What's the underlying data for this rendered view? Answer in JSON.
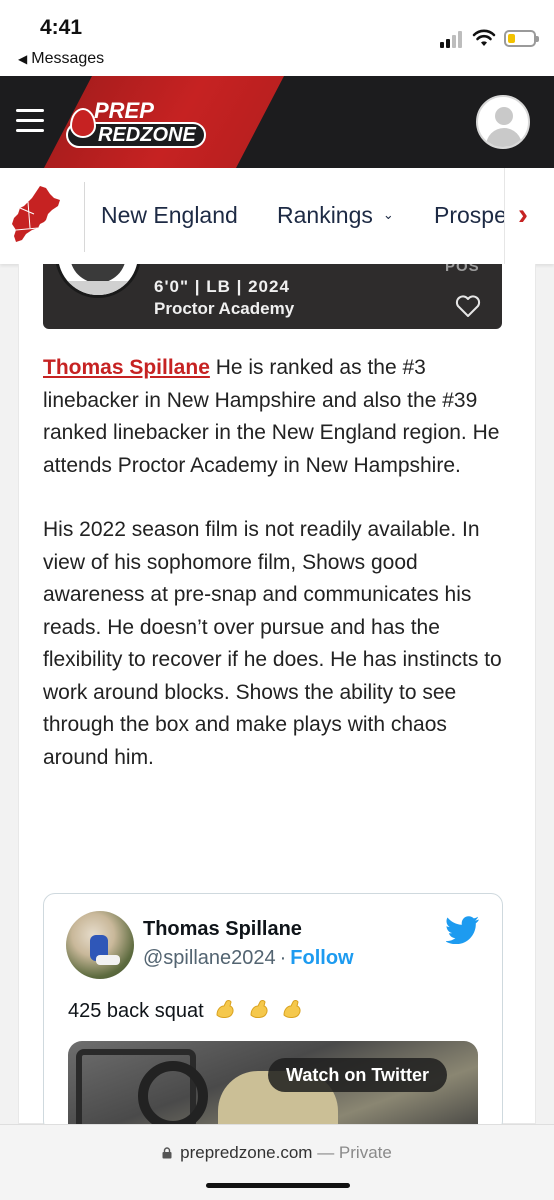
{
  "status_bar": {
    "time": "4:41",
    "back_label": "Messages"
  },
  "header": {
    "logo_top": "PREP",
    "logo_bottom": "REDZONE",
    "brand_red": "#c62222"
  },
  "region_nav": {
    "items": [
      {
        "label": "New England"
      },
      {
        "label": "Rankings"
      },
      {
        "label": "Prospe"
      }
    ]
  },
  "player_card": {
    "pos_label": "POS",
    "info": "6'0\" | LB | 2024",
    "school": "Proctor Academy"
  },
  "article": {
    "player_name": "Thomas Spillane",
    "para1_rest": " He is ranked as the #3 linebacker in New Hampshire and also the #39 ranked linebacker in the New England region. He attends Proctor Academy in New Hampshire.",
    "para2": "His 2022 season film is not readily available. In view of his sophomore film,  Shows good awareness at pre-snap and communicates his reads. He doesn’t over pursue and has the flexibility to recover if he does. He has instincts to work around blocks. Shows the ability to see through the box and make plays with chaos around him."
  },
  "tweet": {
    "name": "Thomas Spillane",
    "handle": "@spillane2024",
    "separator": "·",
    "follow_label": "Follow",
    "text": "425 back squat",
    "watch_label": "Watch on Twitter"
  },
  "safari": {
    "domain": "prepredzone.com",
    "private_label": "— Private"
  }
}
